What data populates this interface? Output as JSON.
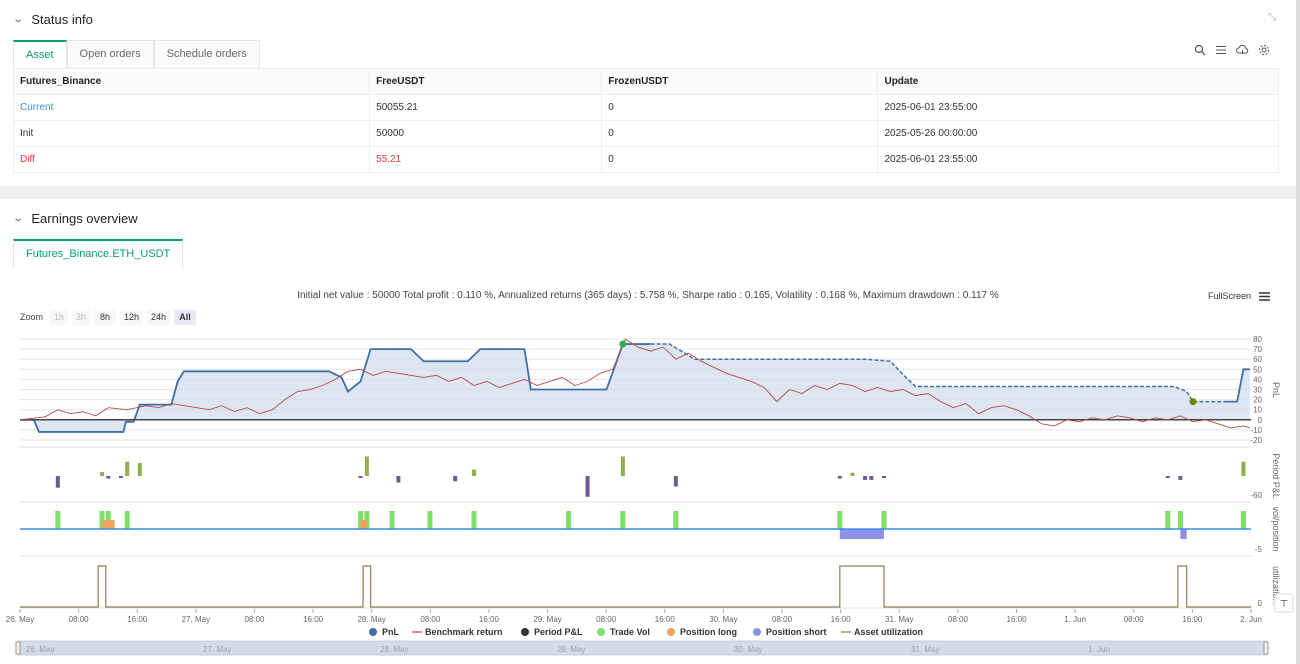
{
  "status": {
    "title": "Status info",
    "tabs": [
      "Asset",
      "Open orders",
      "Schedule orders"
    ],
    "table": {
      "headers": [
        "Futures_Binance",
        "FreeUSDT",
        "FrozenUSDT",
        "Update"
      ],
      "rows": [
        [
          "Current",
          "50055.21",
          "0",
          "2025-06-01 23:55:00"
        ],
        [
          "Init",
          "50000",
          "0",
          "2025-05-26 00:00:00"
        ],
        [
          "Diff",
          "55.21",
          "0",
          "2025-06-01 23:55:00"
        ]
      ]
    },
    "icons": [
      "search-icon",
      "list-icon",
      "cloud-icon",
      "gear-icon",
      "expand-icon"
    ]
  },
  "earnings": {
    "title": "Earnings overview",
    "pair_tab": "Futures_Binance.ETH_USDT",
    "summary": "Initial net value : 50000 Total profit : 0.110 %, Annualized returns (365 days) : 5.758 %, Sharpe ratio : 0.165, Volatility : 0.168 %, Maximum drawdown : 0.117 %",
    "fullscreen": "FullScreen",
    "zoom_label": "Zoom",
    "zoom_options": [
      "1h",
      "3h",
      "8h",
      "12h",
      "24h",
      "All"
    ],
    "zoom_selected": "All"
  },
  "chart_data": {
    "type": "line",
    "x_ticks": [
      "26. May",
      "08:00",
      "16:00",
      "27. May",
      "08:00",
      "16:00",
      "28. May",
      "08:00",
      "16:00",
      "29. May",
      "08:00",
      "16:00",
      "30. May",
      "08:00",
      "16:00",
      "31. May",
      "08:00",
      "16:00",
      "1. Jun",
      "08:00",
      "16:00",
      "2. Jun"
    ],
    "navigator_labels": [
      "26. May",
      "27. May",
      "28. May",
      "29. May",
      "30. May",
      "31. May",
      "1. Jun"
    ],
    "pnl_axis": {
      "label": "PnL",
      "ticks": [
        80,
        70,
        60,
        50,
        40,
        30,
        20,
        10,
        0,
        -10,
        -20
      ],
      "range": [
        -20,
        80
      ]
    },
    "period_axis": {
      "label": "Period P&L",
      "ticks": [
        -60
      ]
    },
    "vol_axis": {
      "label": "vol/position",
      "ticks": [
        -5
      ]
    },
    "util_axis": {
      "label": "utilizatio...",
      "ticks": [
        0
      ]
    },
    "legend": [
      "PnL",
      "Benchmark return",
      "Period P&L",
      "Trade Vol",
      "Position long",
      "Position short",
      "Asset utilization"
    ],
    "colors": {
      "pnl": "#3f6fa8",
      "benchmark": "#b34a4a",
      "period_pos": "#8fb04a",
      "period_neg": "#6e5b91",
      "trade_vol": "#7ee06a",
      "position_long": "#f3a25e",
      "position_short": "#8f8fe6",
      "utilization": "#8a7f55",
      "zero": "#444444"
    },
    "pnl_series": [
      [
        0,
        0
      ],
      [
        0.11,
        0
      ],
      [
        0.15,
        -12
      ],
      [
        0.45,
        -12
      ],
      [
        0.5,
        -12
      ],
      [
        0.55,
        -12
      ],
      [
        0.65,
        -12
      ],
      [
        0.75,
        -12
      ],
      [
        0.8,
        -12
      ],
      [
        0.82,
        -12
      ],
      [
        0.84,
        -2
      ],
      [
        0.9,
        -2
      ],
      [
        0.95,
        15
      ],
      [
        1.05,
        15
      ],
      [
        1.2,
        15
      ],
      [
        1.25,
        38
      ],
      [
        1.3,
        48
      ],
      [
        2.0,
        48
      ],
      [
        2.1,
        48
      ],
      [
        2.2,
        48
      ],
      [
        2.3,
        48
      ],
      [
        2.35,
        48
      ],
      [
        2.45,
        48
      ],
      [
        2.55,
        42
      ],
      [
        2.6,
        28
      ],
      [
        2.7,
        38
      ],
      [
        2.78,
        70
      ],
      [
        3.0,
        70
      ],
      [
        3.1,
        70
      ],
      [
        3.2,
        58
      ],
      [
        3.4,
        58
      ],
      [
        3.55,
        58
      ],
      [
        3.65,
        70
      ],
      [
        3.8,
        70
      ],
      [
        3.95,
        70
      ],
      [
        4.0,
        70
      ],
      [
        4.05,
        30
      ],
      [
        4.1,
        30
      ],
      [
        4.2,
        30
      ],
      [
        4.3,
        30
      ],
      [
        4.4,
        30
      ],
      [
        4.5,
        30
      ],
      [
        4.65,
        30
      ],
      [
        4.78,
        75
      ],
      [
        4.95,
        75
      ],
      [
        5.0,
        75
      ],
      [
        5.1,
        75
      ],
      [
        5.15,
        75
      ],
      [
        5.35,
        60
      ],
      [
        5.45,
        60
      ],
      [
        5.6,
        60
      ],
      [
        5.9,
        60
      ],
      [
        6.1,
        60
      ],
      [
        6.4,
        60
      ],
      [
        6.7,
        60
      ],
      [
        6.9,
        58
      ],
      [
        7.0,
        45
      ],
      [
        7.1,
        33
      ],
      [
        7.3,
        33
      ],
      [
        7.5,
        33
      ],
      [
        7.8,
        33
      ],
      [
        8.2,
        33
      ],
      [
        8.5,
        33
      ],
      [
        8.9,
        33
      ],
      [
        9.15,
        33
      ],
      [
        9.25,
        28
      ],
      [
        9.3,
        18
      ],
      [
        9.5,
        18
      ],
      [
        9.55,
        18
      ],
      [
        9.6,
        18
      ],
      [
        9.65,
        18
      ],
      [
        9.7,
        50
      ],
      [
        9.75,
        50
      ]
    ],
    "benchmark_series": [
      [
        0,
        0
      ],
      [
        0.2,
        3
      ],
      [
        0.3,
        10
      ],
      [
        0.4,
        6
      ],
      [
        0.5,
        8
      ],
      [
        0.6,
        4
      ],
      [
        0.7,
        12
      ],
      [
        0.85,
        10
      ],
      [
        1.0,
        14
      ],
      [
        1.1,
        12
      ],
      [
        1.2,
        16
      ],
      [
        1.3,
        14
      ],
      [
        1.4,
        12
      ],
      [
        1.5,
        10
      ],
      [
        1.6,
        14
      ],
      [
        1.7,
        8
      ],
      [
        1.8,
        12
      ],
      [
        1.9,
        6
      ],
      [
        2.0,
        10
      ],
      [
        2.1,
        20
      ],
      [
        2.2,
        28
      ],
      [
        2.3,
        30
      ],
      [
        2.4,
        34
      ],
      [
        2.5,
        40
      ],
      [
        2.6,
        48
      ],
      [
        2.7,
        50
      ],
      [
        2.8,
        44
      ],
      [
        2.9,
        48
      ],
      [
        3.0,
        46
      ],
      [
        3.1,
        44
      ],
      [
        3.2,
        42
      ],
      [
        3.3,
        44
      ],
      [
        3.4,
        38
      ],
      [
        3.5,
        42
      ],
      [
        3.6,
        34
      ],
      [
        3.7,
        38
      ],
      [
        3.8,
        32
      ],
      [
        3.9,
        36
      ],
      [
        4.0,
        40
      ],
      [
        4.1,
        34
      ],
      [
        4.2,
        38
      ],
      [
        4.3,
        42
      ],
      [
        4.4,
        34
      ],
      [
        4.5,
        38
      ],
      [
        4.6,
        46
      ],
      [
        4.7,
        50
      ],
      [
        4.8,
        80
      ],
      [
        4.9,
        72
      ],
      [
        5.0,
        68
      ],
      [
        5.1,
        72
      ],
      [
        5.2,
        60
      ],
      [
        5.3,
        66
      ],
      [
        5.4,
        58
      ],
      [
        5.5,
        52
      ],
      [
        5.6,
        46
      ],
      [
        5.7,
        42
      ],
      [
        5.8,
        38
      ],
      [
        5.9,
        32
      ],
      [
        6.0,
        18
      ],
      [
        6.1,
        30
      ],
      [
        6.2,
        26
      ],
      [
        6.3,
        34
      ],
      [
        6.4,
        30
      ],
      [
        6.5,
        36
      ],
      [
        6.6,
        34
      ],
      [
        6.7,
        28
      ],
      [
        6.8,
        32
      ],
      [
        6.9,
        28
      ],
      [
        7.0,
        30
      ],
      [
        7.1,
        24
      ],
      [
        7.2,
        26
      ],
      [
        7.3,
        18
      ],
      [
        7.4,
        12
      ],
      [
        7.5,
        16
      ],
      [
        7.6,
        6
      ],
      [
        7.7,
        12
      ],
      [
        7.8,
        14
      ],
      [
        7.9,
        10
      ],
      [
        8.0,
        4
      ],
      [
        8.1,
        -4
      ],
      [
        8.2,
        -6
      ],
      [
        8.3,
        0
      ],
      [
        8.4,
        -2
      ],
      [
        8.5,
        2
      ],
      [
        8.6,
        0
      ],
      [
        8.7,
        4
      ],
      [
        8.8,
        2
      ],
      [
        8.9,
        -2
      ],
      [
        9.0,
        2
      ],
      [
        9.1,
        0
      ],
      [
        9.2,
        4
      ],
      [
        9.3,
        -2
      ],
      [
        9.4,
        0
      ],
      [
        9.5,
        -4
      ],
      [
        9.6,
        -8
      ],
      [
        9.7,
        -6
      ],
      [
        9.75,
        -8
      ]
    ],
    "pnl_markers": [
      {
        "x": 4.78,
        "y": 75,
        "color": "#2ab14c"
      },
      {
        "x": 9.3,
        "y": 18,
        "color": "#6b8a14"
      }
    ],
    "period_bars": [
      [
        0.3,
        -18
      ],
      [
        0.65,
        6
      ],
      [
        0.7,
        -4
      ],
      [
        0.8,
        -3
      ],
      [
        0.85,
        22
      ],
      [
        0.95,
        20
      ],
      [
        2.7,
        -3
      ],
      [
        2.75,
        30
      ],
      [
        3.0,
        -10
      ],
      [
        3.45,
        -8
      ],
      [
        3.6,
        10
      ],
      [
        4.5,
        -32
      ],
      [
        4.78,
        30
      ],
      [
        5.2,
        -16
      ],
      [
        6.5,
        -4
      ],
      [
        6.6,
        5
      ],
      [
        6.7,
        -6
      ],
      [
        6.75,
        -6
      ],
      [
        6.85,
        -2
      ],
      [
        9.1,
        -3
      ],
      [
        9.2,
        -6
      ],
      [
        9.7,
        22
      ]
    ],
    "trade_vol_bars": [
      0.3,
      0.65,
      0.7,
      0.85,
      2.7,
      2.75,
      2.95,
      3.25,
      3.6,
      4.35,
      4.78,
      5.2,
      6.5,
      6.85,
      9.1,
      9.2,
      9.7
    ],
    "long_pos": [
      [
        0.65,
        0.75
      ],
      [
        2.7,
        2.75
      ]
    ],
    "short_pos": [
      [
        6.5,
        6.85
      ],
      [
        9.2,
        9.25
      ]
    ],
    "util_spans": [
      [
        0.62,
        0.68
      ],
      [
        2.72,
        2.78
      ],
      [
        6.5,
        6.85
      ],
      [
        9.18,
        9.25
      ]
    ]
  }
}
